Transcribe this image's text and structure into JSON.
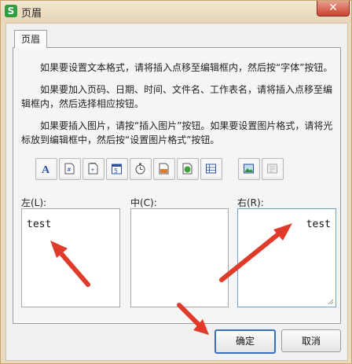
{
  "window": {
    "title": "页眉",
    "app_icon": "S",
    "close_glyph": "✕"
  },
  "tab": {
    "label": "页眉"
  },
  "instructions": [
    "如果要设置文本格式，请将插入点移至编辑框内，然后按“字体”按钮。",
    "如果要加入页码、日期、时间、文件名、工作表名，请将插入点移至编辑框内，然后选择相应按钮。",
    "如果要插入图片，请按“插入图片”按钮。如果要设置图片格式，请将光标放到编辑框中，然后按“设置图片格式”按钮。"
  ],
  "toolbar_icons": [
    "font-icon",
    "page-number-icon",
    "total-pages-icon",
    "date-icon",
    "time-icon",
    "file-path-icon",
    "file-name-icon",
    "sheet-name-icon",
    "insert-picture-icon",
    "format-picture-icon"
  ],
  "regions": {
    "left": {
      "label": "左(L):",
      "value": "test"
    },
    "center": {
      "label": "中(C):",
      "value": ""
    },
    "right": {
      "label": "右(R):",
      "value": "test"
    }
  },
  "buttons": {
    "ok": "确定",
    "cancel": "取消"
  },
  "colors": {
    "accent": "#3a6fb8",
    "arrow": "#e03a2a"
  }
}
